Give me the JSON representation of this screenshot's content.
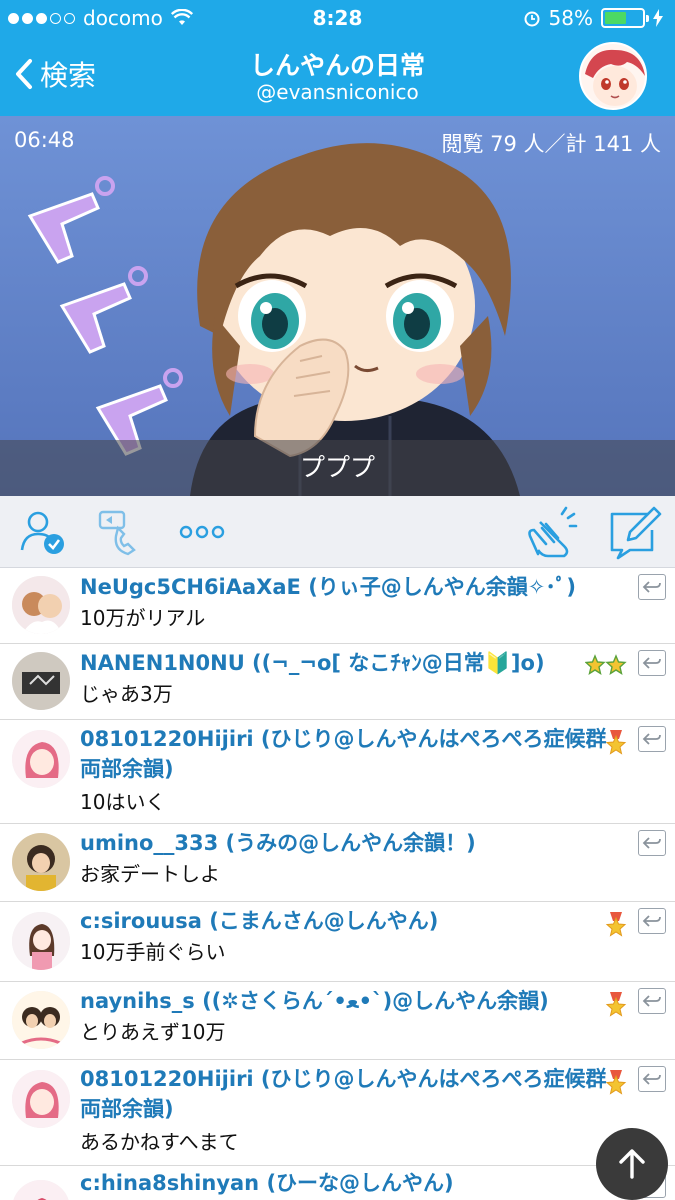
{
  "status": {
    "carrier": "docomo",
    "time": "8:28",
    "battery": "58%",
    "battery_level": 0.58
  },
  "nav": {
    "back_label": "検索",
    "title": "しんやんの日常",
    "subtitle": "@evansniconico"
  },
  "video": {
    "elapsed": "06:48",
    "viewers": "閲覧 79 人／計 141 人",
    "caption": "プププ",
    "art_text": "プププ"
  },
  "toolbar": {
    "icons": [
      "follow-check-icon",
      "voice-call-icon",
      "more-icon",
      "clap-icon",
      "compose-icon"
    ]
  },
  "comments": [
    {
      "user": "NeUgc5CH6iAaXaE (りぃ子@しんやん余韻✧･ﾟ)",
      "text": "10万がリアル",
      "badge": ""
    },
    {
      "user": "NANEN1N0NU ((¬_¬o[ なこﾁｬﾝ@日常🔰]o)",
      "text": "じゃあ3万",
      "badge": "double-star"
    },
    {
      "user": "08101220Hijiri (ひじり@しんやんはぺろぺろ症候群両部余韻)",
      "text": "10はいく",
      "badge": "medal"
    },
    {
      "user": "umino__333 (うみの@しんやん余韻！)",
      "text": "お家デートしよ",
      "badge": ""
    },
    {
      "user": "c:sirouusa (こまんさん@しんやん)",
      "text": "10万手前ぐらい",
      "badge": "medal"
    },
    {
      "user": "naynihs_s ((✲さくらん´•ﻌ•`)@しんやん余韻)",
      "text": "とりあえず10万",
      "badge": "medal"
    },
    {
      "user": "08101220Hijiri (ひじり@しんやんはぺろぺろ症候群両部余韻)",
      "text": "あるかねすへまて",
      "badge": "medal"
    },
    {
      "user": "c:hina8shinyan (ひーな@しんやん)",
      "text": "",
      "badge": ""
    }
  ],
  "colors": {
    "header": "#1fa9e8",
    "username": "#1f7ab8",
    "toolbar_icon": "#2a9fe0"
  }
}
